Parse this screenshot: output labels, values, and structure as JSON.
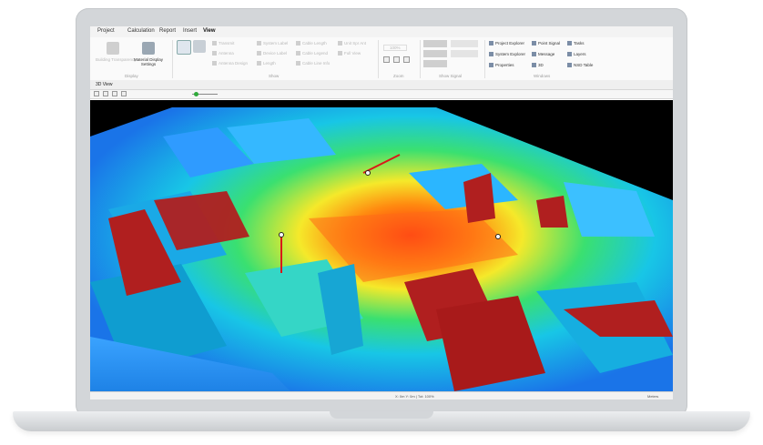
{
  "menu": {
    "tabs": [
      "Project",
      "Calculation",
      "Report",
      "Insert",
      "View"
    ],
    "active_tab": "View"
  },
  "ribbon": {
    "display": {
      "building_transparency": "Building Transparency",
      "material_display_settings": "Material Display Settings",
      "group_label": "Display"
    },
    "show": {
      "col1": [
        "Transmit",
        "Antenna",
        "Antenna Design"
      ],
      "col2": [
        "System Label",
        "Device Label",
        "Length"
      ],
      "col3": [
        "Cable Length",
        "Cable Legend",
        "Cable Line Info"
      ],
      "col4": [
        "Unit Spr Ant",
        "Full View"
      ],
      "group_label": "Show"
    },
    "zoom": {
      "value": "100%",
      "group_label": "Zoom"
    },
    "show_signal": {
      "group_label": "Show Signal"
    },
    "windows": {
      "items": [
        "Project Explorer",
        "Point Signal",
        "Tasks",
        "System Explorer",
        "Message",
        "Layers",
        "Properties",
        "3D",
        "NSD Table"
      ],
      "group_label": "Windows"
    }
  },
  "document_tab": "3D View",
  "status": {
    "coords": "X: 0m Y: 0m | Tot: 100%",
    "right": "Meters"
  },
  "colors": {
    "laptop_frame": "#d3d6d9",
    "heat_high": "#ff3a1a",
    "heat_mid": "#f5e92a",
    "heat_low": "#1f8cff",
    "walls": "#b01f1f"
  },
  "icons": [
    "building-icon",
    "material-icon",
    "window-icon",
    "zoom-icon",
    "grid-icon",
    "antenna-icon"
  ]
}
